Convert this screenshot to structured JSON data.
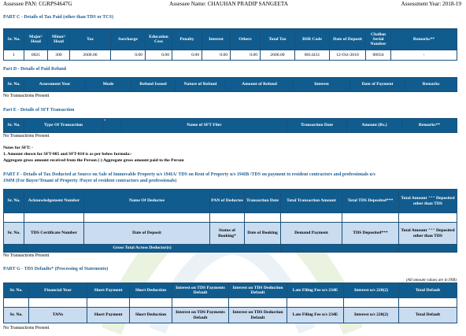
{
  "header": {
    "pan": "Assessee PAN: CGRPS4647G",
    "name": "Assessee Name: CHAUHAN PRADIP SANGEETA",
    "year": "Assessment Year: 2018-19"
  },
  "part_c": {
    "title": "PART C - Details of Tax Paid (other than TDS or TCS)",
    "columns": [
      "Sr. No.",
      "Major¹ Head",
      "Minor² Head",
      "Tax",
      "Surcharge",
      "Education Cess",
      "Penalty",
      "Interest",
      "Others",
      "Total Tax",
      "BSR Code",
      "Date of Deposit",
      "Challan Serial Number",
      "Remarks**"
    ],
    "rows": [
      [
        "1",
        "0021",
        "300",
        "2600.00",
        "0.00",
        "0.00",
        "0.00",
        "0.00",
        "0.00",
        "2600.00",
        "0014431",
        "12-Oct-2018",
        "00034",
        "-"
      ]
    ]
  },
  "part_d": {
    "title": "Part D - Details of Paid Refund",
    "columns": [
      "Sr. No.",
      "Assessment Year",
      "Mode",
      "Refund Issued",
      "Nature of Refund",
      "Amount of Refund",
      "Interest",
      "Date of Payment",
      "Remarks"
    ],
    "empty": "No Transactions Present"
  },
  "part_e": {
    "title": "Part E - Details of SFT Transaction",
    "columns": [
      "Sr. No.",
      "Type Of Transaction",
      "⁴",
      "Name of SFT Filer",
      "Transaction Date",
      "Amount (Rs.)",
      "Remarks**"
    ],
    "empty": "No Transactions Present"
  },
  "sft_notes": {
    "heading": "Notes for SFT: -",
    "line1": "1. Amount shown for SFT-005 and SFT-010 is as per below formula:-",
    "line2": "Aggregate gross amount received from the Person (-) Aggregate gross amount paid to the Person"
  },
  "part_f": {
    "title_line1": "PART F - Details of Tax Deducted at Source on Sale of Immovable Property u/s 194IA/ TDS on Rent of Property u/s 194IB /TDS on payment to resident contractors and professionals u/s",
    "title_line2": "194M (For Buyer/Tenant of Property /Payer of resident contractors and professionals)",
    "columns": [
      "Sr. No.",
      "Acknowledgement Number",
      "Name Of Deductee",
      "PAN of Deductee",
      "Transaction Date",
      "Total Transaction Amount",
      "Total TDS Deposited***",
      "Total Amount ⁺⁺⁺ Deposited other than TDS"
    ],
    "sub_columns": [
      "Sr. No.",
      "TDS Certificate Number",
      "Date of Deposit",
      "Status of Booking*",
      "Date of Booking",
      "Demand Payment",
      "TDS Deposited***",
      "Total Amount ⁺⁺⁺ Deposited other than TDS"
    ],
    "gross_label": "Gross Total Across Deductor(s)",
    "empty": "No Transactions Present"
  },
  "part_g": {
    "title": "PART G - TDS Defaults* (Processing of Statements)",
    "note": "(All amount values are in INR)",
    "columns": [
      "Sr. No.",
      "Financial Year",
      "Short Payment",
      "Short Deduction",
      "Interest on TDS Payments Default",
      "Interest on TDS Deduction Default",
      "Late Filing Fee u/s 234E",
      "Interest u/s 220(2)",
      "Total Default"
    ],
    "sub_columns": [
      "Sr. No.",
      "TANs",
      "Short Payment",
      "Short Deduction",
      "Interest on TDS Payments Default",
      "Interest on TDS Deduction Default",
      "Late Filing Fee u/s 234E",
      "Interest u/s 220(2)",
      "Total Default"
    ],
    "empty": "No Transactions Present"
  },
  "colors": {
    "header_blue": "#115c8e",
    "section_blue": "#1d5f95",
    "light_row": "#c9dcf0",
    "watermark": "#e5f1da"
  }
}
